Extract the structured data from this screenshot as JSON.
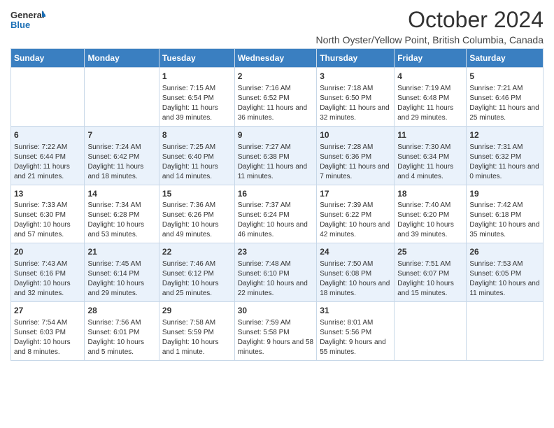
{
  "logo": {
    "line1": "General",
    "line2": "Blue"
  },
  "title": "October 2024",
  "subtitle": "North Oyster/Yellow Point, British Columbia, Canada",
  "headers": [
    "Sunday",
    "Monday",
    "Tuesday",
    "Wednesday",
    "Thursday",
    "Friday",
    "Saturday"
  ],
  "weeks": [
    [
      {
        "day": "",
        "info": ""
      },
      {
        "day": "",
        "info": ""
      },
      {
        "day": "1",
        "info": "Sunrise: 7:15 AM\nSunset: 6:54 PM\nDaylight: 11 hours and 39 minutes."
      },
      {
        "day": "2",
        "info": "Sunrise: 7:16 AM\nSunset: 6:52 PM\nDaylight: 11 hours and 36 minutes."
      },
      {
        "day": "3",
        "info": "Sunrise: 7:18 AM\nSunset: 6:50 PM\nDaylight: 11 hours and 32 minutes."
      },
      {
        "day": "4",
        "info": "Sunrise: 7:19 AM\nSunset: 6:48 PM\nDaylight: 11 hours and 29 minutes."
      },
      {
        "day": "5",
        "info": "Sunrise: 7:21 AM\nSunset: 6:46 PM\nDaylight: 11 hours and 25 minutes."
      }
    ],
    [
      {
        "day": "6",
        "info": "Sunrise: 7:22 AM\nSunset: 6:44 PM\nDaylight: 11 hours and 21 minutes."
      },
      {
        "day": "7",
        "info": "Sunrise: 7:24 AM\nSunset: 6:42 PM\nDaylight: 11 hours and 18 minutes."
      },
      {
        "day": "8",
        "info": "Sunrise: 7:25 AM\nSunset: 6:40 PM\nDaylight: 11 hours and 14 minutes."
      },
      {
        "day": "9",
        "info": "Sunrise: 7:27 AM\nSunset: 6:38 PM\nDaylight: 11 hours and 11 minutes."
      },
      {
        "day": "10",
        "info": "Sunrise: 7:28 AM\nSunset: 6:36 PM\nDaylight: 11 hours and 7 minutes."
      },
      {
        "day": "11",
        "info": "Sunrise: 7:30 AM\nSunset: 6:34 PM\nDaylight: 11 hours and 4 minutes."
      },
      {
        "day": "12",
        "info": "Sunrise: 7:31 AM\nSunset: 6:32 PM\nDaylight: 11 hours and 0 minutes."
      }
    ],
    [
      {
        "day": "13",
        "info": "Sunrise: 7:33 AM\nSunset: 6:30 PM\nDaylight: 10 hours and 57 minutes."
      },
      {
        "day": "14",
        "info": "Sunrise: 7:34 AM\nSunset: 6:28 PM\nDaylight: 10 hours and 53 minutes."
      },
      {
        "day": "15",
        "info": "Sunrise: 7:36 AM\nSunset: 6:26 PM\nDaylight: 10 hours and 49 minutes."
      },
      {
        "day": "16",
        "info": "Sunrise: 7:37 AM\nSunset: 6:24 PM\nDaylight: 10 hours and 46 minutes."
      },
      {
        "day": "17",
        "info": "Sunrise: 7:39 AM\nSunset: 6:22 PM\nDaylight: 10 hours and 42 minutes."
      },
      {
        "day": "18",
        "info": "Sunrise: 7:40 AM\nSunset: 6:20 PM\nDaylight: 10 hours and 39 minutes."
      },
      {
        "day": "19",
        "info": "Sunrise: 7:42 AM\nSunset: 6:18 PM\nDaylight: 10 hours and 35 minutes."
      }
    ],
    [
      {
        "day": "20",
        "info": "Sunrise: 7:43 AM\nSunset: 6:16 PM\nDaylight: 10 hours and 32 minutes."
      },
      {
        "day": "21",
        "info": "Sunrise: 7:45 AM\nSunset: 6:14 PM\nDaylight: 10 hours and 29 minutes."
      },
      {
        "day": "22",
        "info": "Sunrise: 7:46 AM\nSunset: 6:12 PM\nDaylight: 10 hours and 25 minutes."
      },
      {
        "day": "23",
        "info": "Sunrise: 7:48 AM\nSunset: 6:10 PM\nDaylight: 10 hours and 22 minutes."
      },
      {
        "day": "24",
        "info": "Sunrise: 7:50 AM\nSunset: 6:08 PM\nDaylight: 10 hours and 18 minutes."
      },
      {
        "day": "25",
        "info": "Sunrise: 7:51 AM\nSunset: 6:07 PM\nDaylight: 10 hours and 15 minutes."
      },
      {
        "day": "26",
        "info": "Sunrise: 7:53 AM\nSunset: 6:05 PM\nDaylight: 10 hours and 11 minutes."
      }
    ],
    [
      {
        "day": "27",
        "info": "Sunrise: 7:54 AM\nSunset: 6:03 PM\nDaylight: 10 hours and 8 minutes."
      },
      {
        "day": "28",
        "info": "Sunrise: 7:56 AM\nSunset: 6:01 PM\nDaylight: 10 hours and 5 minutes."
      },
      {
        "day": "29",
        "info": "Sunrise: 7:58 AM\nSunset: 5:59 PM\nDaylight: 10 hours and 1 minute."
      },
      {
        "day": "30",
        "info": "Sunrise: 7:59 AM\nSunset: 5:58 PM\nDaylight: 9 hours and 58 minutes."
      },
      {
        "day": "31",
        "info": "Sunrise: 8:01 AM\nSunset: 5:56 PM\nDaylight: 9 hours and 55 minutes."
      },
      {
        "day": "",
        "info": ""
      },
      {
        "day": "",
        "info": ""
      }
    ]
  ]
}
